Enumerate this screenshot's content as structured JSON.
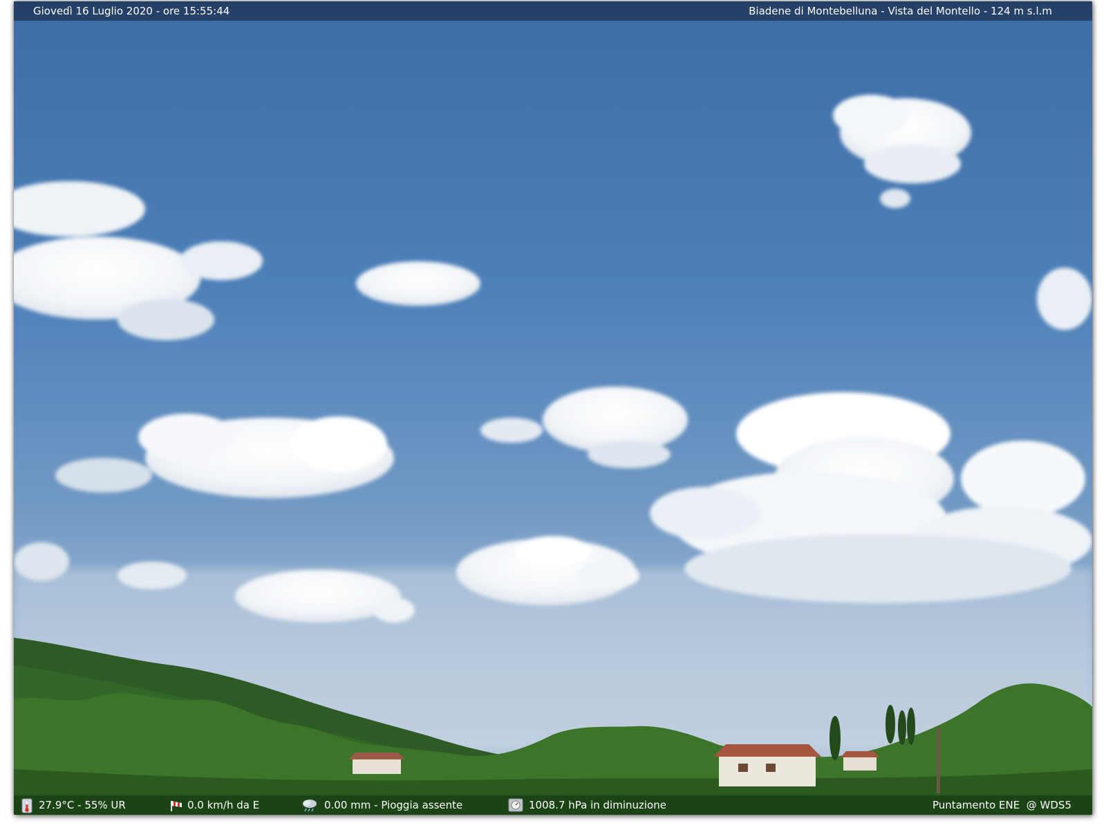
{
  "header": {
    "datetime": "Giovedì 16 Luglio 2020 - ore 15:55:44",
    "location": "Biadene di Montebelluna - Vista del Montello - 124 m s.l.m"
  },
  "footer": {
    "temperature_humidity": "27.9°C - 55% UR",
    "wind": "0.0 km/h da E",
    "rain": "0.00 mm - Pioggia assente",
    "pressure": "1008.7 hPa in diminuzione",
    "pointing": "Puntamento ENE  @ WDS5"
  },
  "icons": {
    "temperature": "thermometer-icon",
    "wind": "windsock-icon",
    "rain": "rain-cloud-icon",
    "pressure": "barometer-icon"
  },
  "colors": {
    "sky_top": "#3f6fa8",
    "sky_bottom": "#b9cadc",
    "hill": "#2f5a26",
    "vegetation": "#3f7a2c"
  }
}
